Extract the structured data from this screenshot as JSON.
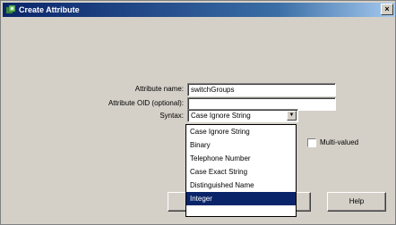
{
  "dialog": {
    "title": "Create Attribute",
    "close_glyph": "×",
    "icon": "directory-attribute-icon"
  },
  "form": {
    "attribute_name_label": "Attribute name:",
    "attribute_name_value": "switchGroups",
    "attribute_oid_label": "Attribute OID (optional):",
    "attribute_oid_value": "",
    "syntax_label": "Syntax:",
    "syntax_selected": "Case Ignore String",
    "multi_valued_label": "Multi-valued",
    "multi_valued_checked": false
  },
  "syntax_options": [
    {
      "label": "Case Ignore String",
      "highlighted": false
    },
    {
      "label": "Binary",
      "highlighted": false
    },
    {
      "label": "Telephone Number",
      "highlighted": false
    },
    {
      "label": "Case Exact String",
      "highlighted": false
    },
    {
      "label": "Distinguished Name",
      "highlighted": false
    },
    {
      "label": "Integer",
      "highlighted": true
    }
  ],
  "buttons": {
    "ok_label": "",
    "help_label": "Help"
  },
  "colors": {
    "titlebar": "#0a246a",
    "face": "#d4d0c8",
    "highlight": "#0a246a"
  }
}
